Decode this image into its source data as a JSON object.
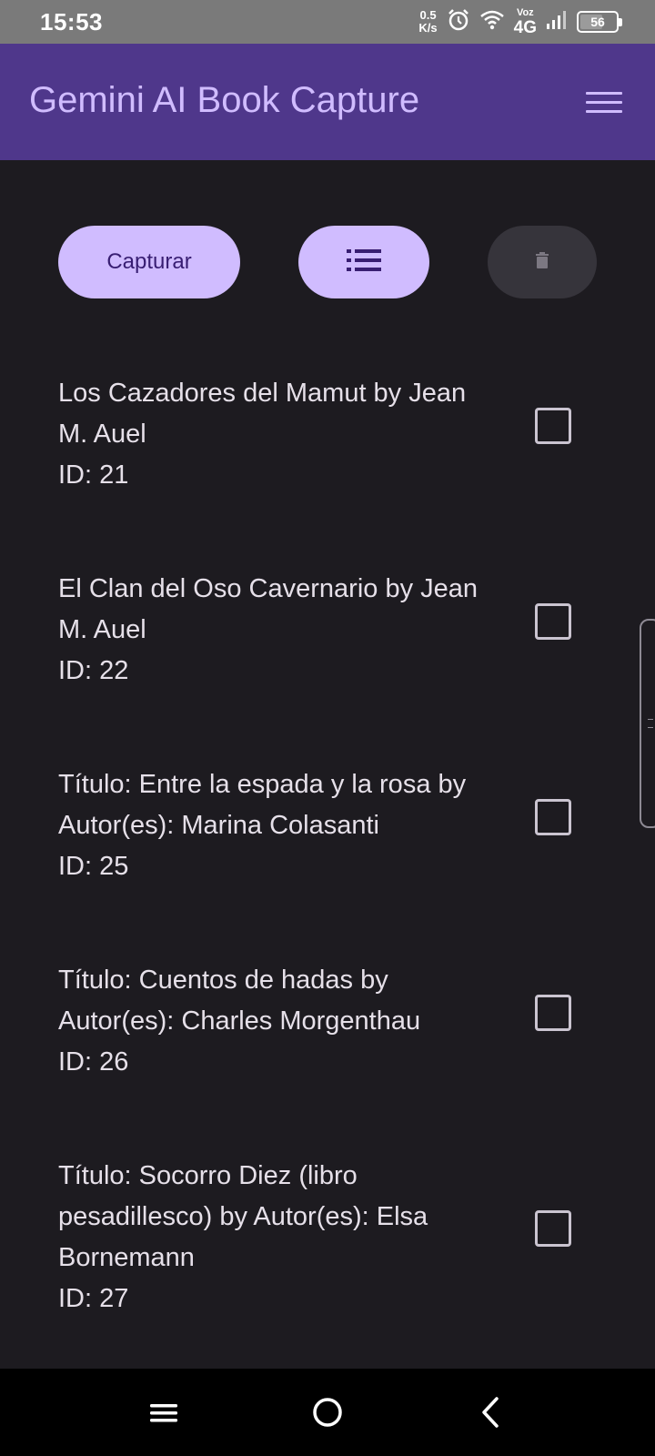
{
  "status_bar": {
    "time": "15:53",
    "net_speed_value": "0.5",
    "net_speed_unit": "K/s",
    "network_voz": "Voz",
    "network_type": "4G",
    "battery_level": "56",
    "icons": [
      "alarm-icon",
      "wifi-icon",
      "signal-icon",
      "battery-icon"
    ]
  },
  "app_bar": {
    "title": "Gemini AI Book Capture",
    "menu_icon": "hamburger-menu-icon"
  },
  "actions": {
    "capture_label": "Capturar",
    "list_icon": "list-icon",
    "delete_icon": "trash-icon"
  },
  "books": [
    {
      "line1": "Los Cazadores del Mamut by Jean",
      "line2": "M. Auel",
      "id": "ID: 21",
      "checked": false
    },
    {
      "line1": "El Clan del Oso Cavernario by Jean",
      "line2": "M. Auel",
      "id": "ID: 22",
      "checked": false
    },
    {
      "line1": "Título: Entre la espada y la rosa by",
      "line2": "Autor(es): Marina Colasanti",
      "id": "ID: 25",
      "checked": false
    },
    {
      "line1": "Título: Cuentos de hadas by",
      "line2": "Autor(es): Charles Morgenthau",
      "id": "ID: 26",
      "checked": false
    },
    {
      "line1": "Título: Socorro Diez (libro",
      "line2": "pesadillesco) by Autor(es): Elsa",
      "line3": "Bornemann",
      "id": "ID: 27",
      "checked": false
    }
  ],
  "nav_bar": {
    "recents_icon": "recents-icon",
    "home_icon": "home-icon",
    "back_icon": "back-icon"
  },
  "colors": {
    "background": "#1d1b20",
    "app_bar": "#4f378b",
    "primary": "#d0bcff",
    "on_primary_container": "#381e72",
    "text": "#e6e0e9",
    "disabled_button": "#36343b"
  }
}
